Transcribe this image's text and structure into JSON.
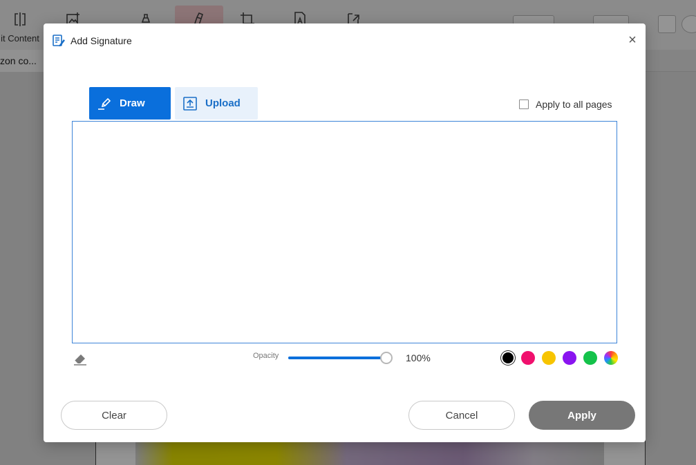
{
  "background": {
    "toolbar_items": [
      {
        "label": "it Content",
        "icon": "edit-content-icon"
      },
      {
        "label": "",
        "icon": "add-image-icon"
      },
      {
        "label": "",
        "icon": "redact-icon"
      },
      {
        "label": "",
        "icon": "signature-tool-icon"
      },
      {
        "label": "",
        "icon": "crop-icon"
      },
      {
        "label": "",
        "icon": "text-icon"
      },
      {
        "label": "",
        "icon": "extract-icon"
      }
    ],
    "doc_tab": "zon co..."
  },
  "dialog": {
    "title": "Add Signature",
    "close_icon": "close-icon",
    "tabs": [
      {
        "label": "Draw",
        "icon": "pen-icon",
        "active": true
      },
      {
        "label": "Upload",
        "icon": "upload-icon",
        "active": false
      }
    ],
    "apply_all": {
      "label": "Apply to all pages",
      "checked": false
    },
    "opacity": {
      "label": "Opacity",
      "value": 100,
      "display": "100%"
    },
    "colors": [
      {
        "name": "black",
        "hex": "#000000",
        "selected": true
      },
      {
        "name": "pink",
        "hex": "#f0106d",
        "selected": false
      },
      {
        "name": "yellow",
        "hex": "#f7c400",
        "selected": false
      },
      {
        "name": "purple",
        "hex": "#8a14f0",
        "selected": false
      },
      {
        "name": "green",
        "hex": "#14c24a",
        "selected": false
      },
      {
        "name": "custom",
        "hex": "rainbow",
        "selected": false
      }
    ],
    "buttons": {
      "clear": "Clear",
      "cancel": "Cancel",
      "apply": "Apply"
    }
  }
}
